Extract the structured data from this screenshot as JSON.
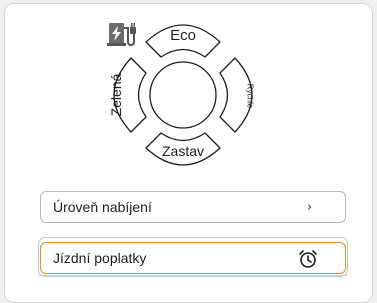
{
  "mode_dial": {
    "top_label": "Eco",
    "left_label": "Zelená",
    "right_label": "Rychle",
    "bottom_label": "Zastav",
    "center_icon": "ev-charger-icon"
  },
  "menu": {
    "items": [
      {
        "label": "Úroveň nabíjení",
        "trailing": "›",
        "trailing_icon": "chevron-right-icon"
      },
      {
        "label": "Jízdní poplatky",
        "trailing_icon": "alarm-clock-icon"
      }
    ]
  },
  "colors": {
    "accent_orange": "#f08a24",
    "outline": "#1e1e1e",
    "panel_bg": "#ffffff",
    "page_bg": "#efefef"
  }
}
